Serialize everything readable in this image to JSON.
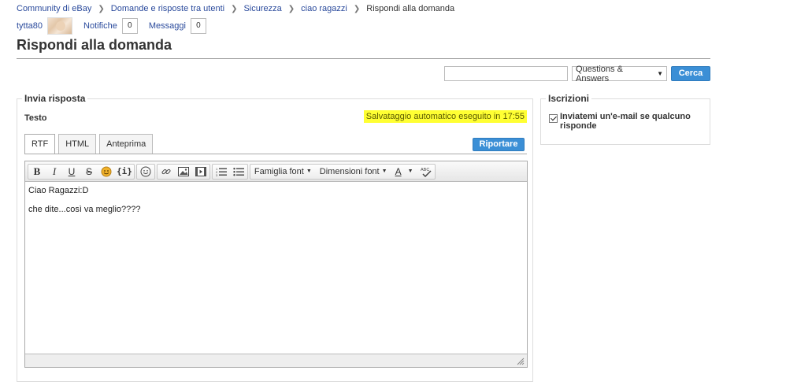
{
  "breadcrumb": [
    {
      "label": "Community di eBay"
    },
    {
      "label": "Domande e risposte tra utenti"
    },
    {
      "label": "Sicurezza"
    },
    {
      "label": "ciao ragazzi"
    },
    {
      "label": "Rispondi alla domanda"
    }
  ],
  "user": {
    "name": "tytta80",
    "notifiche_label": "Notifiche",
    "notifiche_count": "0",
    "messaggi_label": "Messaggi",
    "messaggi_count": "0"
  },
  "page_title": "Rispondi alla domanda",
  "search": {
    "value": "",
    "scope": "Questions & Answers",
    "button": "Cerca"
  },
  "reply": {
    "panel_title": "Invia risposta",
    "field_label": "Testo",
    "autosave": "Salvataggio automatico eseguito in 17:55",
    "tabs": [
      "RTF",
      "HTML",
      "Anteprima"
    ],
    "active_tab": "RTF",
    "report_button": "Riportare",
    "toolbar": {
      "bold": "B",
      "italic": "I",
      "underline": "U",
      "strike": "S",
      "code": "{i}",
      "font_family": "Famiglia font",
      "font_size": "Dimensioni font",
      "font_color": "A",
      "spellcheck": "ABC"
    },
    "body": [
      "Ciao Ragazzi:D",
      "che dite...così va meglio????"
    ]
  },
  "subscriptions": {
    "title": "Iscrizioni",
    "checkbox_label": "Inviatemi un'e-mail se qualcuno risponde",
    "checked": true
  },
  "colors": {
    "link": "#2a4a9c",
    "button": "#3b8fd6",
    "highlight": "#ffff33"
  }
}
